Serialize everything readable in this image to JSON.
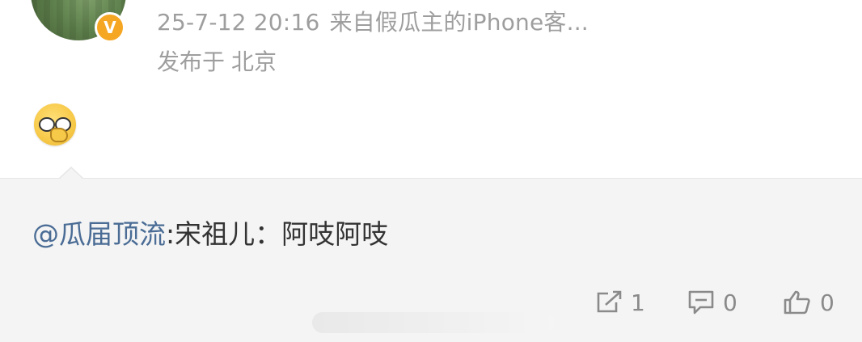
{
  "post": {
    "timestamp": "25-7-12 20:16",
    "source": "来自假瓜主的iPhone客...",
    "location_prefix": "发布于",
    "location_city": "北京",
    "emoji_icon": "nerd-glasses-emoji"
  },
  "quoted": {
    "mention": "@瓜届顶流",
    "text": ":宋祖儿：阿吱阿吱"
  },
  "actions": {
    "repost_count": "1",
    "comment_count": "0",
    "like_count": "0"
  },
  "colors": {
    "meta": "#9e9e9e",
    "mention": "#4a6c95",
    "quoted_bg": "#f4f4f4",
    "badge": "#f5a623"
  }
}
